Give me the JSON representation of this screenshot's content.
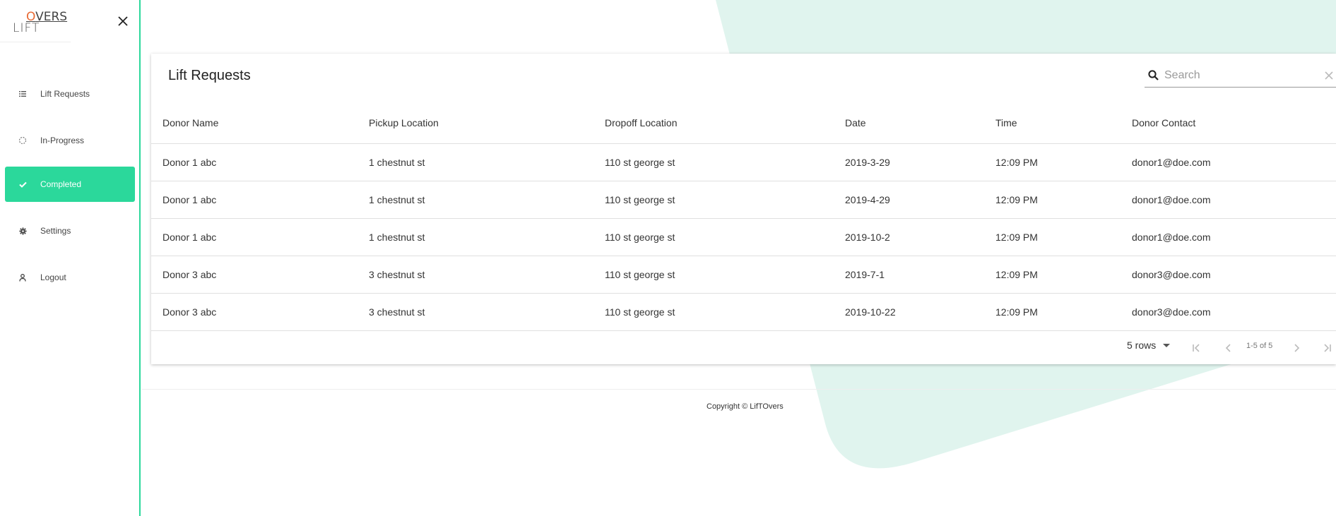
{
  "brand": {
    "logo_prefix": "LIFT",
    "logo_o": "O",
    "logo_suffix": "VERS"
  },
  "colors": {
    "accent": "#2bd89b",
    "logo_accent": "#e86a34",
    "bg_shape": "#e0f4ee"
  },
  "sidebar": {
    "close_icon": "close-icon",
    "items": [
      {
        "label": "Lift Requests",
        "icon": "list-icon",
        "active": false
      },
      {
        "label": "In-Progress",
        "icon": "spinner-icon",
        "active": false
      },
      {
        "label": "Completed",
        "icon": "check-icon",
        "active": true
      },
      {
        "label": "Settings",
        "icon": "gear-icon",
        "active": false
      },
      {
        "label": "Logout",
        "icon": "user-icon",
        "active": false
      }
    ]
  },
  "main": {
    "title": "Lift Requests",
    "search": {
      "placeholder": "Search",
      "value": ""
    },
    "table": {
      "columns": [
        "Donor Name",
        "Pickup Location",
        "Dropoff Location",
        "Date",
        "Time",
        "Donor Contact"
      ],
      "rows": [
        [
          "Donor 1 abc",
          "1 chestnut st",
          "110 st george st",
          "2019-3-29",
          "12:09 PM",
          "donor1@doe.com"
        ],
        [
          "Donor 1 abc",
          "1 chestnut st",
          "110 st george st",
          "2019-4-29",
          "12:09 PM",
          "donor1@doe.com"
        ],
        [
          "Donor 1 abc",
          "1 chestnut st",
          "110 st george st",
          "2019-10-2",
          "12:09 PM",
          "donor1@doe.com"
        ],
        [
          "Donor 3 abc",
          "3 chestnut st",
          "110 st george st",
          "2019-7-1",
          "12:09 PM",
          "donor3@doe.com"
        ],
        [
          "Donor 3 abc",
          "3 chestnut st",
          "110 st george st",
          "2019-10-22",
          "12:09 PM",
          "donor3@doe.com"
        ]
      ]
    },
    "pagination": {
      "rows_label": "5 rows",
      "range_label": "1-5 of 5"
    }
  },
  "footer": {
    "copyright": "Copyright © LifTOvers"
  }
}
